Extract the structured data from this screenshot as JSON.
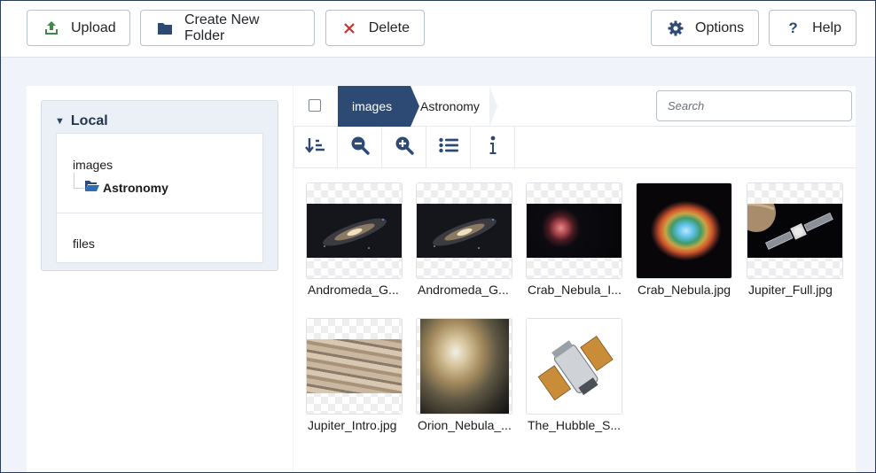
{
  "toolbar": {
    "upload": "Upload",
    "create_folder": "Create New Folder",
    "delete": "Delete",
    "options": "Options",
    "help": "Help"
  },
  "sidebar": {
    "root": "Local",
    "items": {
      "images": "images",
      "astronomy": "Astronomy",
      "files": "files"
    }
  },
  "breadcrumb": [
    "images",
    "Astronomy"
  ],
  "search": {
    "placeholder": "Search",
    "value": ""
  },
  "view_tools": [
    "sort-icon",
    "zoom-out-icon",
    "zoom-in-icon",
    "list-view-icon",
    "info-icon"
  ],
  "files": [
    "Andromeda_G...",
    "Andromeda_G...",
    "Crab_Nebula_I...",
    "Crab_Nebula.jpg",
    "Jupiter_Full.jpg",
    "Jupiter_Intro.jpg",
    "Orion_Nebula_...",
    "The_Hubble_S..."
  ],
  "colors": {
    "accent": "#2d4a74",
    "upload_icon": "#3f8a4a",
    "delete_icon": "#c9302c",
    "icon": "#2d4a74"
  }
}
